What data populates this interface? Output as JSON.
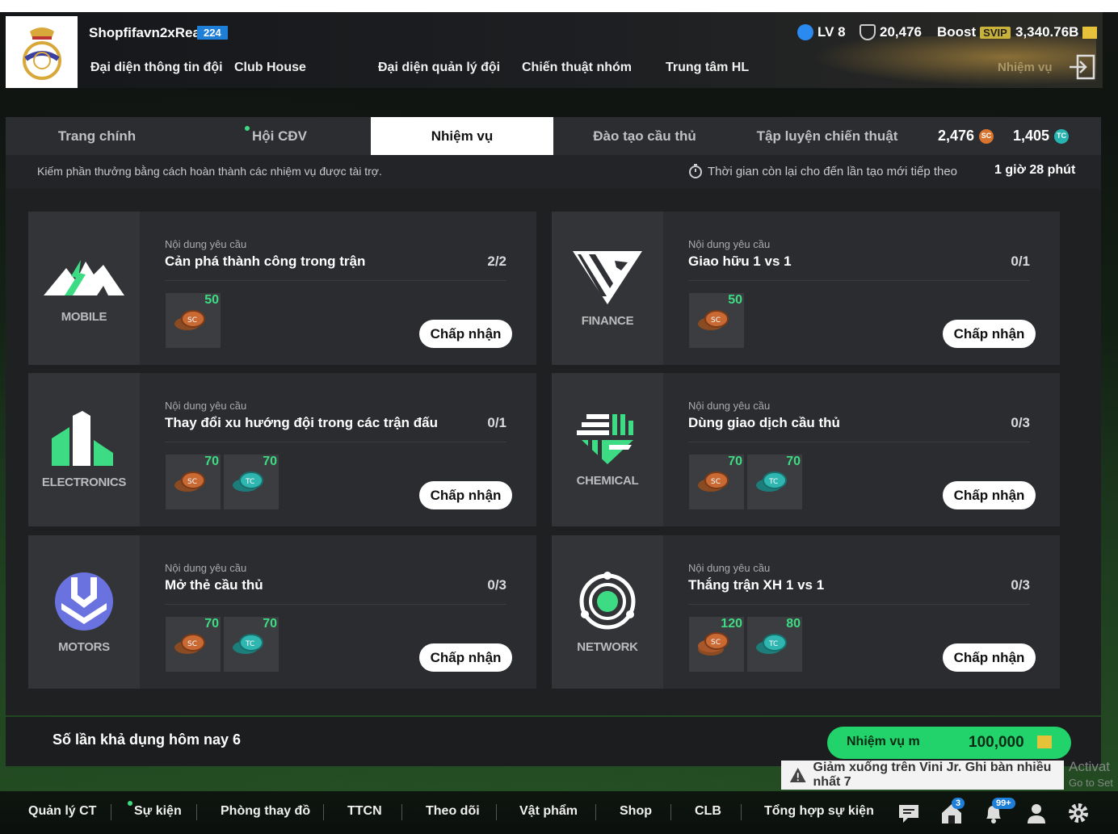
{
  "header": {
    "team_name": "Shopfifavn2xReal",
    "team_level": "224",
    "nav": [
      "Đại diện thông tin đội",
      "Club House",
      "Đại diện quản lý đội",
      "Chiến thuật nhóm",
      "Trung tâm HL"
    ],
    "level": "LV 8",
    "ovr": "20,476",
    "boost": "Boost",
    "svip": "SVIP",
    "bp": "3,340.76B",
    "ghost_label": "Nhiệm vụ"
  },
  "tabs": {
    "items": [
      "Trang chính",
      "Hội CĐV",
      "Nhiệm vụ",
      "Đào tạo cầu thủ",
      "Tập luyện chiến thuật"
    ],
    "active": "Nhiệm vụ",
    "sc_amount": "2,476",
    "tc_amount": "1,405",
    "sc_icon": "SC",
    "tc_icon": "TC"
  },
  "subbar": {
    "hint": "Kiếm phần thưởng bằng cách hoàn thành các nhiệm vụ được tài trợ.",
    "timer_label": "Thời gian còn lại cho đến lần tạo mới tiếp theo",
    "timer_value": "1 giờ 28 phút"
  },
  "missions": [
    {
      "brand": "MOBILE",
      "req_label": "Nội dung yêu cầu",
      "title": "Cản phá thành công trong trận",
      "progress": "2/2",
      "rewards": [
        {
          "type": "SC",
          "qty": "50"
        }
      ],
      "accept": "Chấp nhận"
    },
    {
      "brand": "FINANCE",
      "req_label": "Nội dung yêu cầu",
      "title": "Giao hữu 1 vs 1",
      "progress": "0/1",
      "rewards": [
        {
          "type": "SC",
          "qty": "50"
        }
      ],
      "accept": "Chấp nhận"
    },
    {
      "brand": "ELECTRONICS",
      "req_label": "Nội dung yêu cầu",
      "title": "Thay đổi xu hướng đội trong các trận đấu",
      "progress": "0/1",
      "rewards": [
        {
          "type": "SC",
          "qty": "70"
        },
        {
          "type": "TC",
          "qty": "70"
        }
      ],
      "accept": "Chấp nhận"
    },
    {
      "brand": "CHEMICAL",
      "req_label": "Nội dung yêu cầu",
      "title": "Dùng giao dịch cầu thủ",
      "progress": "0/3",
      "rewards": [
        {
          "type": "SC",
          "qty": "70"
        },
        {
          "type": "TC",
          "qty": "70"
        }
      ],
      "accept": "Chấp nhận"
    },
    {
      "brand": "MOTORS",
      "req_label": "Nội dung yêu cầu",
      "title": "Mở thẻ cầu thủ",
      "progress": "0/3",
      "rewards": [
        {
          "type": "SC",
          "qty": "70"
        },
        {
          "type": "TC",
          "qty": "70"
        }
      ],
      "accept": "Chấp nhận"
    },
    {
      "brand": "NETWORK",
      "req_label": "Nội dung yêu cầu",
      "title": "Thắng trận XH 1 vs 1",
      "progress": "0/3",
      "rewards": [
        {
          "type": "SC",
          "qty": "120"
        },
        {
          "type": "TC",
          "qty": "80"
        }
      ],
      "accept": "Chấp nhận"
    }
  ],
  "footer": {
    "available": "Số lần khả dụng hôm nay 6",
    "mission_label": "Nhiệm vụ m",
    "mission_value": "100,000"
  },
  "toast": "Giảm xuống trên Vini Jr. Ghi bàn nhiều nhất 7",
  "activate": [
    "Activat",
    "Go to Set"
  ],
  "bottom_nav": [
    "Quản lý CT",
    "Sự kiện",
    "Phòng thay đồ",
    "TTCN",
    "Theo dõi",
    "Vật phẩm",
    "Shop",
    "CLB",
    "Tổng hợp sự kiện"
  ],
  "badges": {
    "home": "3",
    "bell": "99+"
  },
  "colors": {
    "accent": "#3ddc84",
    "svip": "#c8b23a",
    "level_badge": "#1e7fd8"
  }
}
